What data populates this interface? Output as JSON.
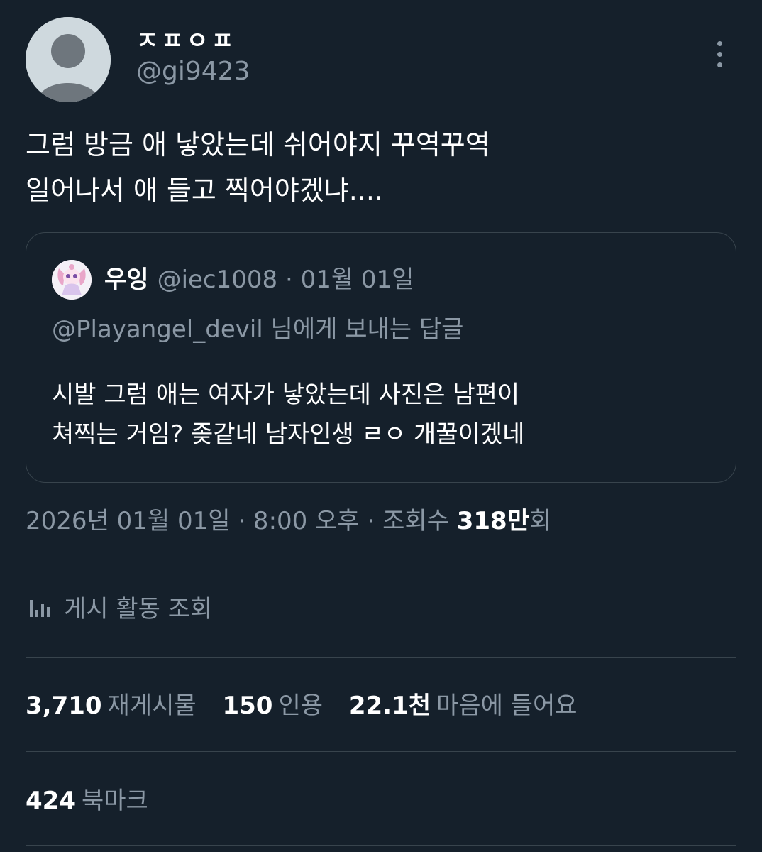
{
  "author": {
    "display_name": "ㅈㅍㅇㅍ",
    "handle": "@gi9423",
    "avatar_icon": "default-avatar-icon"
  },
  "more_icon": "more-vertical-icon",
  "tweet": {
    "lines": [
      "그럼 방금 애 낳았는데 쉬어야지 꾸역꾸역",
      "일어나서 애 들고 찍어야겠냐...."
    ]
  },
  "quote": {
    "avatar_icon": "character-avatar-icon",
    "name": "우잉",
    "meta": "@iec1008 · 01월 01일",
    "reply_to": "@Playangel_devil 님에게 보내는 답글",
    "lines": [
      "시발 그럼 애는 여자가 낳았는데 사진은 남편이",
      "쳐찍는 거임? 좆같네 남자인생 ㄹㅇ 개꿀이겠네"
    ]
  },
  "timestamp": {
    "text": "2026년 01월 01일 · 8:00 오후 · 조회수 ",
    "views": "318만",
    "suffix": "회"
  },
  "activity": {
    "icon": "analytics-bars-icon",
    "label": "게시 활동 조회"
  },
  "stats": {
    "retweets": {
      "num": "3,710",
      "label": "재게시물"
    },
    "quotes": {
      "num": "150",
      "label": "인용"
    },
    "likes": {
      "num": "22.1천",
      "label": "마음에 들어요"
    }
  },
  "bookmarks": {
    "num": "424",
    "label": "북마크"
  },
  "colors": {
    "background": "#15202b",
    "text_primary": "#ffffff",
    "text_secondary": "#8b98a5",
    "border": "#38444d"
  }
}
